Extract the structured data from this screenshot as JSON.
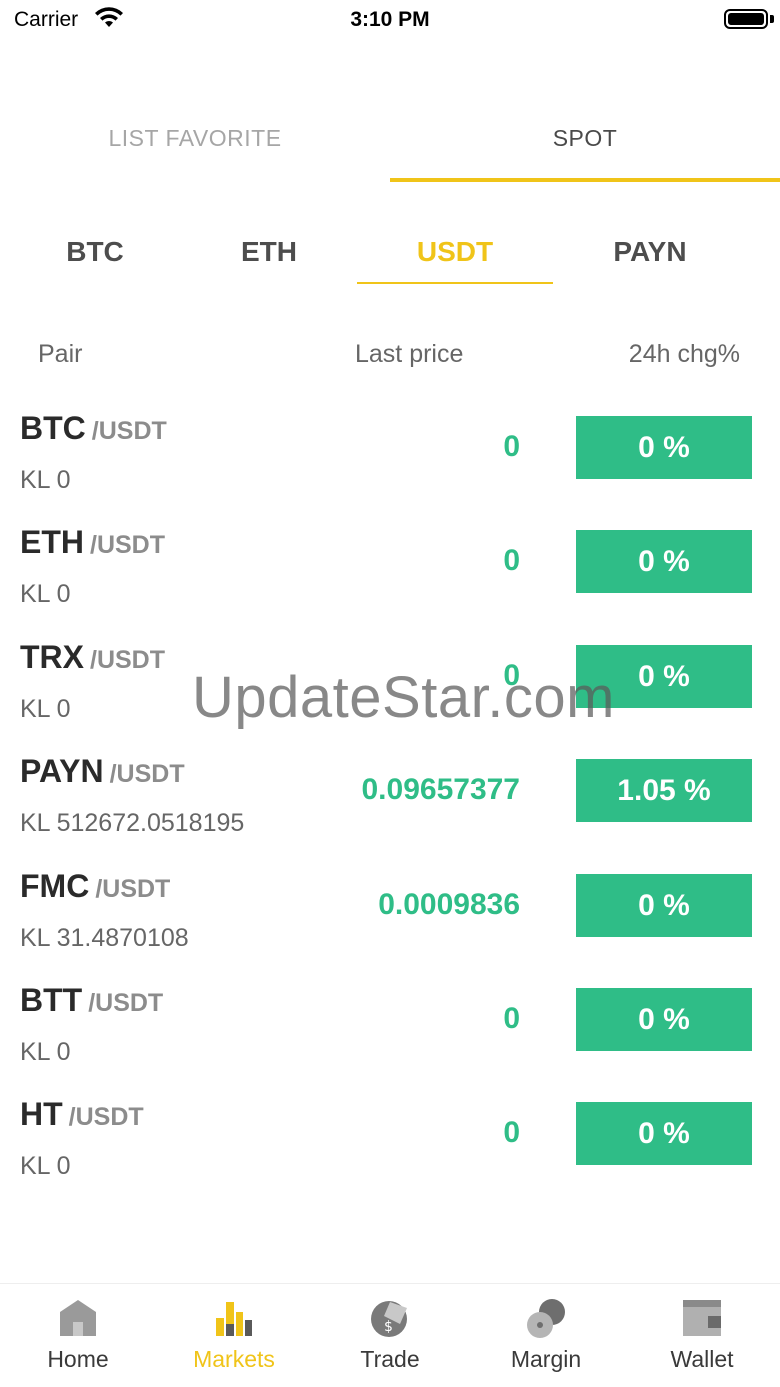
{
  "status_bar": {
    "carrier": "Carrier",
    "time": "3:10 PM"
  },
  "top_tabs": [
    {
      "label": "LIST FAVORITE",
      "active": false
    },
    {
      "label": "SPOT",
      "active": true
    }
  ],
  "coin_tabs": [
    {
      "label": "BTC",
      "active": false
    },
    {
      "label": "ETH",
      "active": false
    },
    {
      "label": "USDT",
      "active": true
    },
    {
      "label": "PAYN",
      "active": false
    }
  ],
  "list_header": {
    "pair": "Pair",
    "last_price": "Last price",
    "change": "24h chg%"
  },
  "rows": [
    {
      "base": "BTC",
      "quote": "/USDT",
      "volume": "KL 0",
      "price": "0",
      "change": "0 %"
    },
    {
      "base": "ETH",
      "quote": "/USDT",
      "volume": "KL 0",
      "price": "0",
      "change": "0 %"
    },
    {
      "base": "TRX",
      "quote": "/USDT",
      "volume": "KL 0",
      "price": "0",
      "change": "0 %"
    },
    {
      "base": "PAYN",
      "quote": "/USDT",
      "volume": "KL 512672.0518195",
      "price": "0.09657377",
      "change": "1.05 %"
    },
    {
      "base": "FMC",
      "quote": "/USDT",
      "volume": "KL 31.4870108",
      "price": "0.0009836",
      "change": "0 %"
    },
    {
      "base": "BTT",
      "quote": "/USDT",
      "volume": "KL 0",
      "price": "0",
      "change": "0 %"
    },
    {
      "base": "HT",
      "quote": "/USDT",
      "volume": "KL 0",
      "price": "0",
      "change": "0 %"
    }
  ],
  "watermark": "UpdateStar.com",
  "bottom_nav": [
    {
      "label": "Home",
      "icon": "home-icon",
      "active": false
    },
    {
      "label": "Markets",
      "icon": "markets-icon",
      "active": true
    },
    {
      "label": "Trade",
      "icon": "trade-icon",
      "active": false
    },
    {
      "label": "Margin",
      "icon": "margin-icon",
      "active": false
    },
    {
      "label": "Wallet",
      "icon": "wallet-icon",
      "active": false
    }
  ],
  "colors": {
    "accent": "#f0c419",
    "positive": "#2fbd87",
    "inactive_tab": "#a6a6a6"
  }
}
